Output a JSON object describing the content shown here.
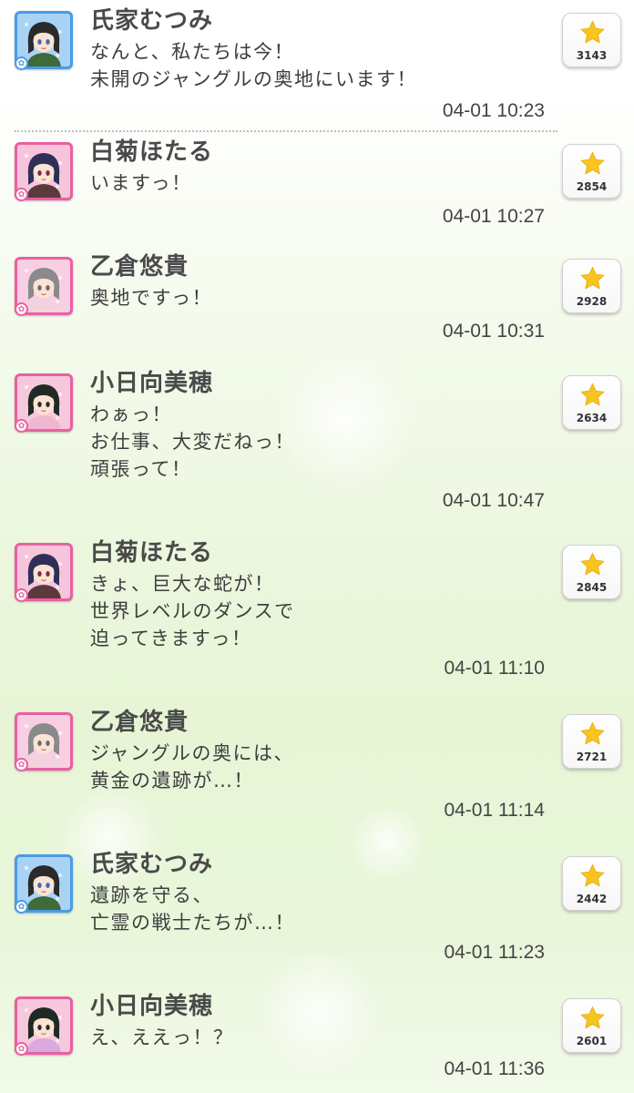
{
  "posts": [
    {
      "name": "氏家むつみ",
      "lines": [
        "なんと、私たちは今！",
        "未開のジャングルの奥地にいます！"
      ],
      "time": "04-01 10:23",
      "stars": "3143",
      "frame": "blue",
      "badge": "cool-type-icon"
    },
    {
      "name": "白菊ほたる",
      "lines": [
        "いますっ！"
      ],
      "time": "04-01 10:27",
      "stars": "2854",
      "frame": "pink",
      "badge": "cute-type-icon"
    },
    {
      "name": "乙倉悠貴",
      "lines": [
        "奥地ですっ！"
      ],
      "time": "04-01 10:31",
      "stars": "2928",
      "frame": "pink",
      "badge": "cute-type-icon"
    },
    {
      "name": "小日向美穂",
      "lines": [
        "わぁっ！",
        "お仕事、大変だねっ！",
        "頑張って！"
      ],
      "time": "04-01 10:47",
      "stars": "2634",
      "frame": "pink",
      "badge": "cute-type-icon"
    },
    {
      "name": "白菊ほたる",
      "lines": [
        "きょ、巨大な蛇が！",
        "世界レベルのダンスで",
        "迫ってきますっ！"
      ],
      "time": "04-01 11:10",
      "stars": "2845",
      "frame": "pink",
      "badge": "cute-type-icon"
    },
    {
      "name": "乙倉悠貴",
      "lines": [
        "ジャングルの奥には、",
        "黄金の遺跡が…！"
      ],
      "time": "04-01 11:14",
      "stars": "2721",
      "frame": "pink",
      "badge": "cute-type-icon"
    },
    {
      "name": "氏家むつみ",
      "lines": [
        "遺跡を守る、",
        "亡霊の戦士たちが…！"
      ],
      "time": "04-01 11:23",
      "stars": "2442",
      "frame": "blue",
      "badge": "cool-type-icon"
    },
    {
      "name": "小日向美穂",
      "lines": [
        "え、ええっ！？"
      ],
      "time": "04-01 11:36",
      "stars": "2601",
      "frame": "pink",
      "badge": "cute-type-icon"
    }
  ],
  "colors": {
    "cool_frame": "#4a9be8",
    "cute_frame": "#ea5fa2",
    "star": "#f7c51e",
    "text": "#3e3e3e"
  }
}
